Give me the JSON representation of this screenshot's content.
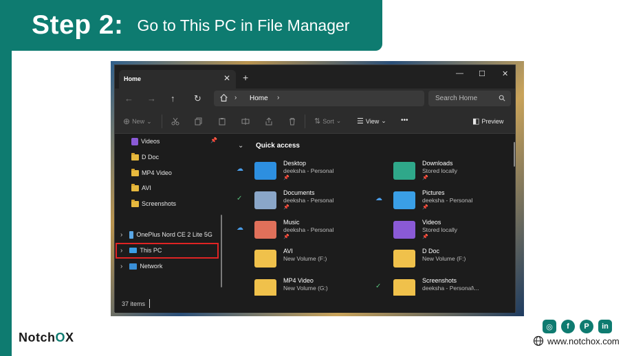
{
  "banner": {
    "step": "Step 2:",
    "subtitle": "Go to This PC in File Manager"
  },
  "window": {
    "tab_title": "Home",
    "tab_close": "✕",
    "new_tab": "+",
    "controls": {
      "minimize": "—",
      "maximize": "☐",
      "close": "✕"
    }
  },
  "navbar": {
    "back": "←",
    "forward": "→",
    "up": "↑",
    "refresh": "↻",
    "chevron": "›",
    "breadcrumb": "Home",
    "search_placeholder": "Search Home"
  },
  "commandbar": {
    "new_label": "New",
    "sort_label": "Sort",
    "view_label": "View",
    "more_label": "•••",
    "preview_label": "Preview"
  },
  "sidebar": {
    "items": [
      {
        "label": "Videos"
      },
      {
        "label": "D Doc"
      },
      {
        "label": "MP4 Video"
      },
      {
        "label": "AVI"
      },
      {
        "label": "Screenshots"
      },
      {
        "label": "OnePlus Nord CE 2 Lite 5G"
      },
      {
        "label": "This PC"
      },
      {
        "label": "Network"
      }
    ],
    "expand": "›"
  },
  "quick_access": {
    "title": "Quick access",
    "chevron": "⌄",
    "pin": "📌",
    "items": [
      {
        "name": "Desktop",
        "desc": "deeksha - Personal",
        "status": "☁",
        "status_color": "#4a9de8",
        "icon_color": "#2d8fe0"
      },
      {
        "name": "Downloads",
        "desc": "Stored locally",
        "status": "",
        "status_color": "#4a9de8",
        "icon_color": "#2fa88a"
      },
      {
        "name": "Documents",
        "desc": "deeksha - Personal",
        "status": "✓",
        "status_color": "#58c27c",
        "icon_color": "#8aa6c8"
      },
      {
        "name": "Pictures",
        "desc": "deeksha - Personal",
        "status": "☁",
        "status_color": "#4a9de8",
        "icon_color": "#3a9fe6"
      },
      {
        "name": "Music",
        "desc": "deeksha - Personal",
        "status": "☁",
        "status_color": "#4a9de8",
        "icon_color": "#e0705a"
      },
      {
        "name": "Videos",
        "desc": "Stored locally",
        "status": "",
        "status_color": "#4a9de8",
        "icon_color": "#8a5ad6"
      },
      {
        "name": "AVI",
        "desc": "New Volume (F:)",
        "status": "",
        "status_color": "#4a9de8",
        "icon_color": "#f0c14b"
      },
      {
        "name": "D Doc",
        "desc": "New Volume (F:)",
        "status": "",
        "status_color": "#4a9de8",
        "icon_color": "#f0c14b"
      },
      {
        "name": "MP4 Video",
        "desc": "New Volume (G:)",
        "status": "",
        "status_color": "#4a9de8",
        "icon_color": "#f0c14b"
      },
      {
        "name": "Screenshots",
        "desc": "deeksha - Personal\\...",
        "status": "✓",
        "status_color": "#58c27c",
        "icon_color": "#f0c14b"
      }
    ]
  },
  "status_bar": {
    "count": "37 items"
  },
  "footer": {
    "brand_a": "Notch",
    "brand_o": "O",
    "brand_b": "X",
    "website": "www.notchox.com",
    "social": {
      "instagram": "◎",
      "facebook": "f",
      "pinterest": "P",
      "linkedin": "in"
    }
  }
}
